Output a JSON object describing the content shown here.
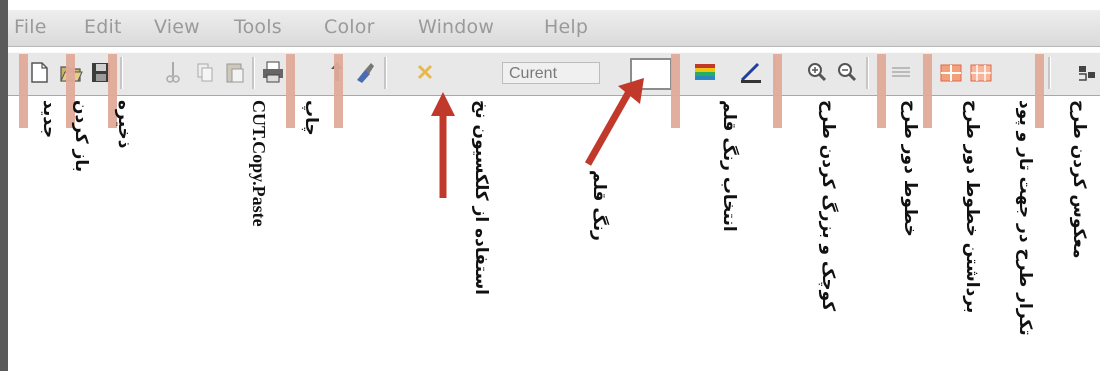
{
  "menubar": {
    "items": [
      "File",
      "Edit",
      "View",
      "Tools",
      "Color",
      "Window",
      "Help"
    ]
  },
  "toolbar": {
    "current_label": "Curent",
    "icons": [
      "new-document-icon",
      "open-folder-icon",
      "save-icon",
      "cut-icon",
      "copy-icon",
      "paste-icon",
      "print-icon",
      "pick-icon",
      "brush-icon",
      "close-icon",
      "pen-color-swatch",
      "palette-icon",
      "color-select-icon",
      "zoom-in-icon",
      "zoom-out-icon",
      "grid-lines-icon",
      "remove-grid-icon",
      "repeat-pattern-icon",
      "reverse-pattern-icon"
    ]
  },
  "labels": {
    "new": "جدید",
    "open": "باز کردن",
    "save": "ذخیره",
    "cut_copy_paste": "CUT.Copy.Paste",
    "print": "چاپ",
    "use_collection": "استفاده از کلکسیون نخ",
    "pen_color": "رنگ قلم",
    "choose_pen_color": "انتخاب رنگ قلم",
    "zoom": "کوچک و بزرگ کردن طرح",
    "outline": "خطوط دور طرح",
    "remove_outline": "برداشتن خطوط دور طرح",
    "repeat": "تکرار طرح در جهت تار و پود",
    "reverse": "معکوس کردن طرح"
  },
  "colors": {
    "callout": "#e0aa98",
    "arrow": "#c0392b"
  }
}
